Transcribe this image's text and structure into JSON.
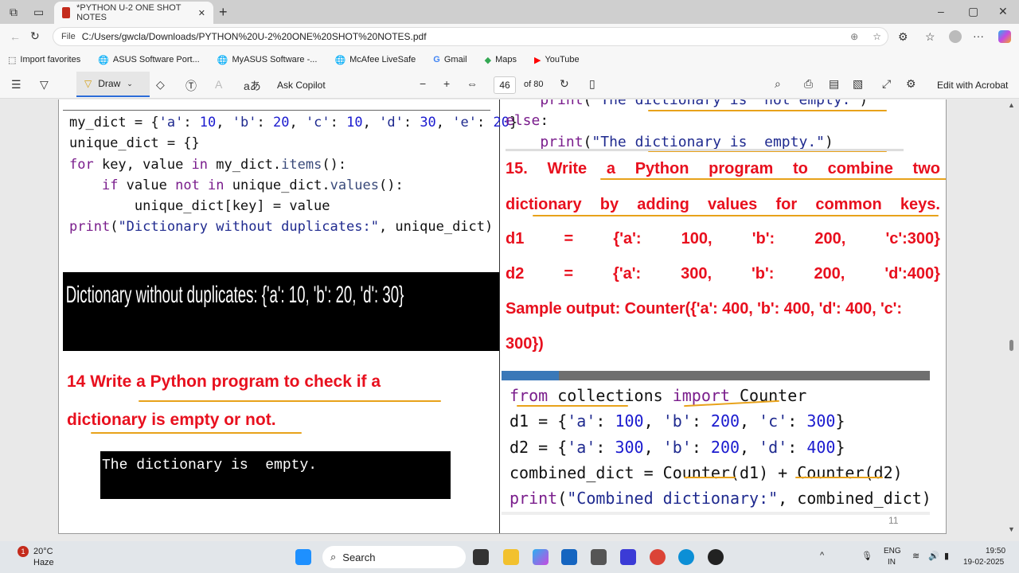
{
  "browser": {
    "tab_title": "*PYTHON U-2 ONE SHOT NOTES",
    "file_chip": "File",
    "url": "C:/Users/gwcla/Downloads/PYTHON%20U-2%20ONE%20SHOT%20NOTES.pdf",
    "bookmarks": [
      "Import favorites",
      "ASUS Software Port...",
      "MyASUS Software -...",
      "McAfee LiveSafe",
      "Gmail",
      "Maps",
      "YouTube"
    ]
  },
  "pdf_toolbar": {
    "draw": "Draw",
    "ask_copilot": "Ask Copilot",
    "page_current": "46",
    "page_total": "of 80",
    "edit_acrobat": "Edit with Acrobat"
  },
  "left": {
    "code": [
      [
        [
          "my_dict = {",
          ""
        ],
        [
          "'a'",
          "str"
        ],
        [
          ": ",
          ""
        ],
        [
          "10",
          "num"
        ],
        [
          ", ",
          ""
        ],
        [
          "'b'",
          "str"
        ],
        [
          ": ",
          ""
        ],
        [
          "20",
          "num"
        ],
        [
          ", ",
          ""
        ],
        [
          "'c'",
          "str"
        ],
        [
          ": ",
          ""
        ],
        [
          "10",
          "num"
        ],
        [
          ", ",
          ""
        ],
        [
          "'d'",
          "str"
        ],
        [
          ": ",
          ""
        ],
        [
          "30",
          "num"
        ],
        [
          ", ",
          ""
        ],
        [
          "'e'",
          "str"
        ],
        [
          ": ",
          ""
        ],
        [
          "20",
          "num"
        ],
        [
          "}",
          ""
        ]
      ],
      [
        [
          "unique_dict = {}",
          ""
        ]
      ],
      [
        [
          "for",
          "kw"
        ],
        [
          " key, value ",
          ""
        ],
        [
          "in",
          "kw"
        ],
        [
          " my_dict.",
          ""
        ],
        [
          "items",
          "fn"
        ],
        [
          "():",
          ""
        ]
      ],
      [
        [
          "    ",
          ""
        ],
        [
          "if",
          "kw"
        ],
        [
          " value ",
          ""
        ],
        [
          "not in",
          "kw"
        ],
        [
          " unique_dict.",
          ""
        ],
        [
          "values",
          "fn"
        ],
        [
          "():",
          ""
        ]
      ],
      [
        [
          "        unique_dict[key] = value",
          ""
        ]
      ],
      [
        [
          "print",
          "kw"
        ],
        [
          "(",
          ""
        ],
        [
          "\"Dictionary without duplicates:\"",
          "str"
        ],
        [
          ", unique_dict)",
          ""
        ]
      ]
    ],
    "output": "Dictionary without duplicates: {'a': 10, 'b': 20, 'd': 30}",
    "q14_line1": "14 Write a Python program to check if a",
    "q14_line2": "dictionary is empty or not.",
    "output2": "The dictionary is  empty."
  },
  "right": {
    "code_top": [
      [
        [
          "    ",
          ""
        ],
        [
          "print",
          "kw"
        ],
        [
          "(",
          ""
        ],
        [
          "\"The dictionary is  not empty.\"",
          "str"
        ],
        [
          ")",
          ""
        ]
      ],
      [
        [
          "else",
          "kw"
        ],
        [
          ":",
          ""
        ]
      ],
      [
        [
          "    ",
          ""
        ],
        [
          "print",
          "kw"
        ],
        [
          "(",
          ""
        ],
        [
          "\"The dictionary is  empty.\"",
          "str"
        ],
        [
          ")",
          ""
        ]
      ]
    ],
    "q15_line1": [
      "15.",
      "Write",
      "a",
      "Python",
      "program",
      "to",
      "combine",
      "two"
    ],
    "q15_line2": [
      "dictionary",
      "by",
      "adding",
      "values",
      "for",
      "common",
      "keys."
    ],
    "d1_line": [
      "d1",
      "=",
      "{'a':",
      "100,",
      "'b':",
      "200,",
      "'c':300}"
    ],
    "d2_line": [
      "d2",
      "=",
      "{'a':",
      "300,",
      "'b':",
      "200,",
      "'d':400}"
    ],
    "sample_line1": "Sample output: Counter({'a': 400, 'b': 400, 'd': 400, 'c':",
    "sample_line2": "300})",
    "code": [
      [
        [
          "from",
          "kw"
        ],
        [
          " collections ",
          ""
        ],
        [
          "import",
          "kw"
        ],
        [
          " Counter",
          ""
        ]
      ],
      [
        [
          "d1 = {",
          ""
        ],
        [
          "'a'",
          "str"
        ],
        [
          ": ",
          ""
        ],
        [
          "100",
          "num"
        ],
        [
          ", ",
          ""
        ],
        [
          "'b'",
          "str"
        ],
        [
          ": ",
          ""
        ],
        [
          "200",
          "num"
        ],
        [
          ", ",
          ""
        ],
        [
          "'c'",
          "str"
        ],
        [
          ": ",
          ""
        ],
        [
          "300",
          "num"
        ],
        [
          "}",
          ""
        ]
      ],
      [
        [
          "d2 = {",
          ""
        ],
        [
          "'a'",
          "str"
        ],
        [
          ": ",
          ""
        ],
        [
          "300",
          "num"
        ],
        [
          ", ",
          ""
        ],
        [
          "'b'",
          "str"
        ],
        [
          ": ",
          ""
        ],
        [
          "200",
          "num"
        ],
        [
          ", ",
          ""
        ],
        [
          "'d'",
          "str"
        ],
        [
          ": ",
          ""
        ],
        [
          "400",
          "num"
        ],
        [
          "}",
          ""
        ]
      ],
      [
        [
          "combined_dict = Counter(d1) + Counter(d2)",
          ""
        ]
      ],
      [
        [
          "print",
          "kw"
        ],
        [
          "(",
          ""
        ],
        [
          "\"Combined dictionary:\"",
          "str"
        ],
        [
          ", combined_dict)",
          ""
        ]
      ]
    ],
    "page_number": "11"
  },
  "taskbar": {
    "weather_temp": "20°C",
    "weather_desc": "Haze",
    "weather_badge": "1",
    "search": "Search",
    "lang1": "ENG",
    "lang2": "IN",
    "time": "19:50",
    "date": "19-02-2025"
  }
}
